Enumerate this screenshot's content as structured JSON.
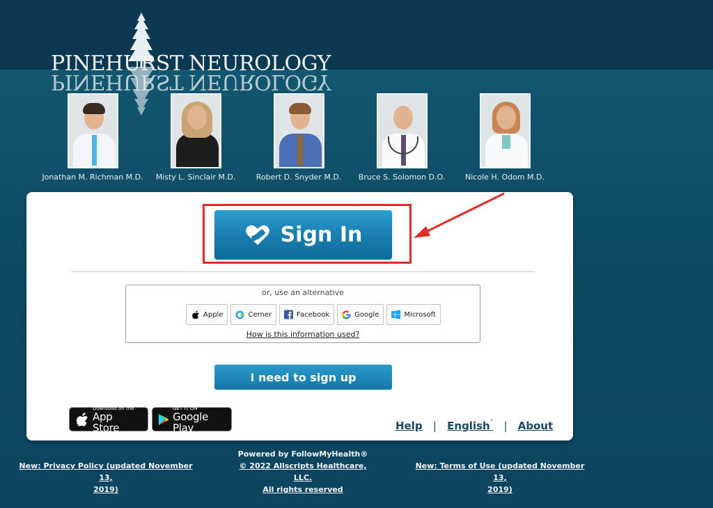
{
  "logo": {
    "word1": "PINEHURST",
    "word2": "NEUROLOGY"
  },
  "doctors": [
    {
      "name": "Jonathan M. Richman M.D."
    },
    {
      "name": "Misty L. Sinclair M.D."
    },
    {
      "name": "Robert D. Snyder M.D."
    },
    {
      "name": "Bruce S. Solomon D.O."
    },
    {
      "name": "Nicole H. Odom M.D."
    }
  ],
  "signin": {
    "label": "Sign In"
  },
  "alternatives": {
    "title": "or, use an alternative",
    "buttons": [
      {
        "label": "Apple"
      },
      {
        "label": "Cerner"
      },
      {
        "label": "Facebook"
      },
      {
        "label": "Google"
      },
      {
        "label": "Microsoft"
      }
    ],
    "info_link": "How is this information used?"
  },
  "signup": {
    "label": "I need to sign up"
  },
  "stores": {
    "apple": {
      "small": "Download on the",
      "big": "App Store"
    },
    "google": {
      "small": "GET IT ON",
      "big": "Google Play"
    }
  },
  "footer": {
    "help": "Help",
    "language": "English",
    "about": "About",
    "sep": "|"
  },
  "bottom": {
    "privacy_line1": "New: Privacy Policy (updated November 13,",
    "privacy_line2": "2019)",
    "powered": "Powered by FollowMyHealth®",
    "copyright": "© 2022 Allscripts Healthcare, LLC.",
    "rights": "All rights reserved",
    "terms_line1": "New: Terms of Use (updated November 13,",
    "terms_line2": "2019)"
  },
  "colors": {
    "highlight": "#e12a2a",
    "primary_button": "#1a7eb0",
    "background": "#0f4b66"
  }
}
